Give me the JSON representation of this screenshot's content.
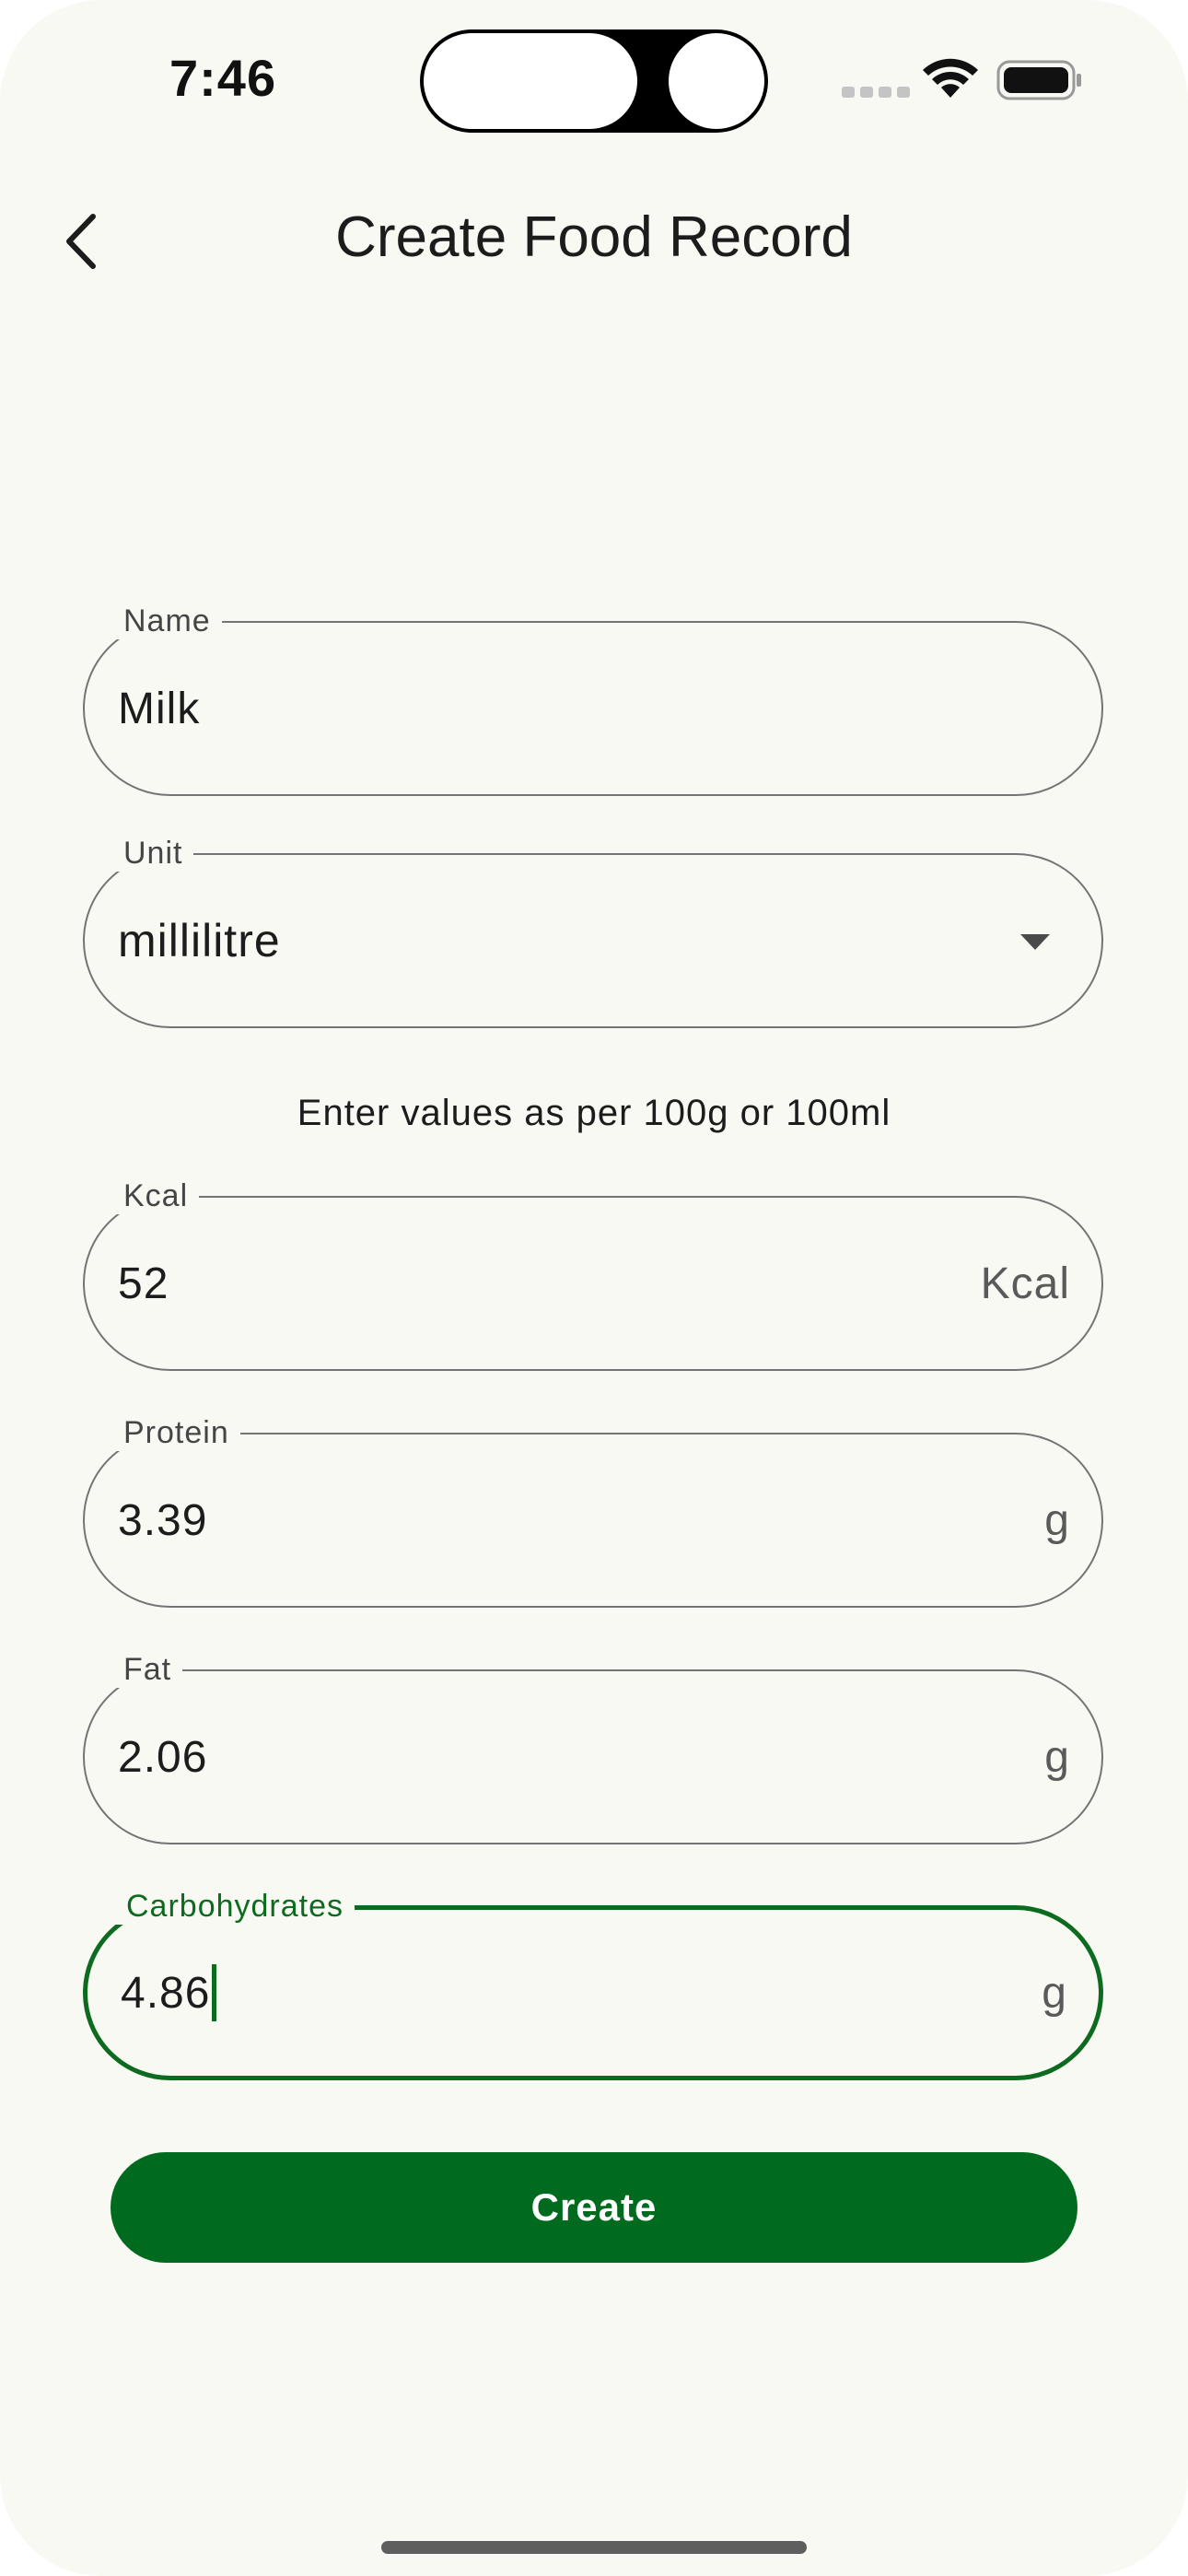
{
  "status_bar": {
    "time": "7:46",
    "icons": [
      "signal-dots-icon",
      "wifi-icon",
      "battery-icon"
    ]
  },
  "header": {
    "back_icon": "chevron-left-icon",
    "title": "Create Food Record"
  },
  "form": {
    "name": {
      "label": "Name",
      "value": "Milk"
    },
    "unit": {
      "label": "Unit",
      "value": "millilitre",
      "icon": "dropdown-arrow-icon"
    },
    "hint": "Enter values as per 100g or 100ml",
    "kcal": {
      "label": "Kcal",
      "value": "52",
      "suffix": "Kcal"
    },
    "protein": {
      "label": "Protein",
      "value": "3.39",
      "suffix": "g"
    },
    "fat": {
      "label": "Fat",
      "value": "2.06",
      "suffix": "g"
    },
    "carbohydrates": {
      "label": "Carbohydrates",
      "value": "4.86",
      "suffix": "g",
      "focused": true
    }
  },
  "actions": {
    "create_label": "Create"
  },
  "colors": {
    "accent": "#006b1e",
    "background": "#f9f9f4",
    "outline": "#747474"
  }
}
